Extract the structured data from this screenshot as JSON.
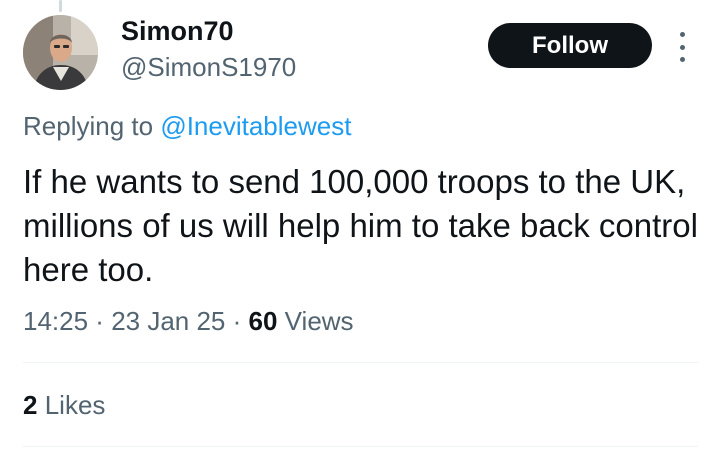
{
  "author": {
    "display_name": "Simon70",
    "handle": "@SimonS1970"
  },
  "follow_label": "Follow",
  "reply": {
    "prefix": "Replying to",
    "mention": "@Inevitablewest"
  },
  "tweet_text": "If he wants to send 100,000 troops to the UK, millions of us will help him to take back control here too.",
  "meta": {
    "time": "14:25",
    "sep1": " · ",
    "date": "23 Jan 25",
    "sep2": " · ",
    "views_count": "60",
    "views_label": "Views"
  },
  "stats": {
    "likes_count": "2",
    "likes_label": "Likes"
  },
  "icons": {
    "more": "more-options-icon",
    "avatar": "avatar"
  },
  "colors": {
    "accent": "#1d9bf0",
    "text_primary": "#0f1419",
    "text_secondary": "#536471",
    "button_bg": "#0f1419",
    "divider": "#eff3f4"
  }
}
